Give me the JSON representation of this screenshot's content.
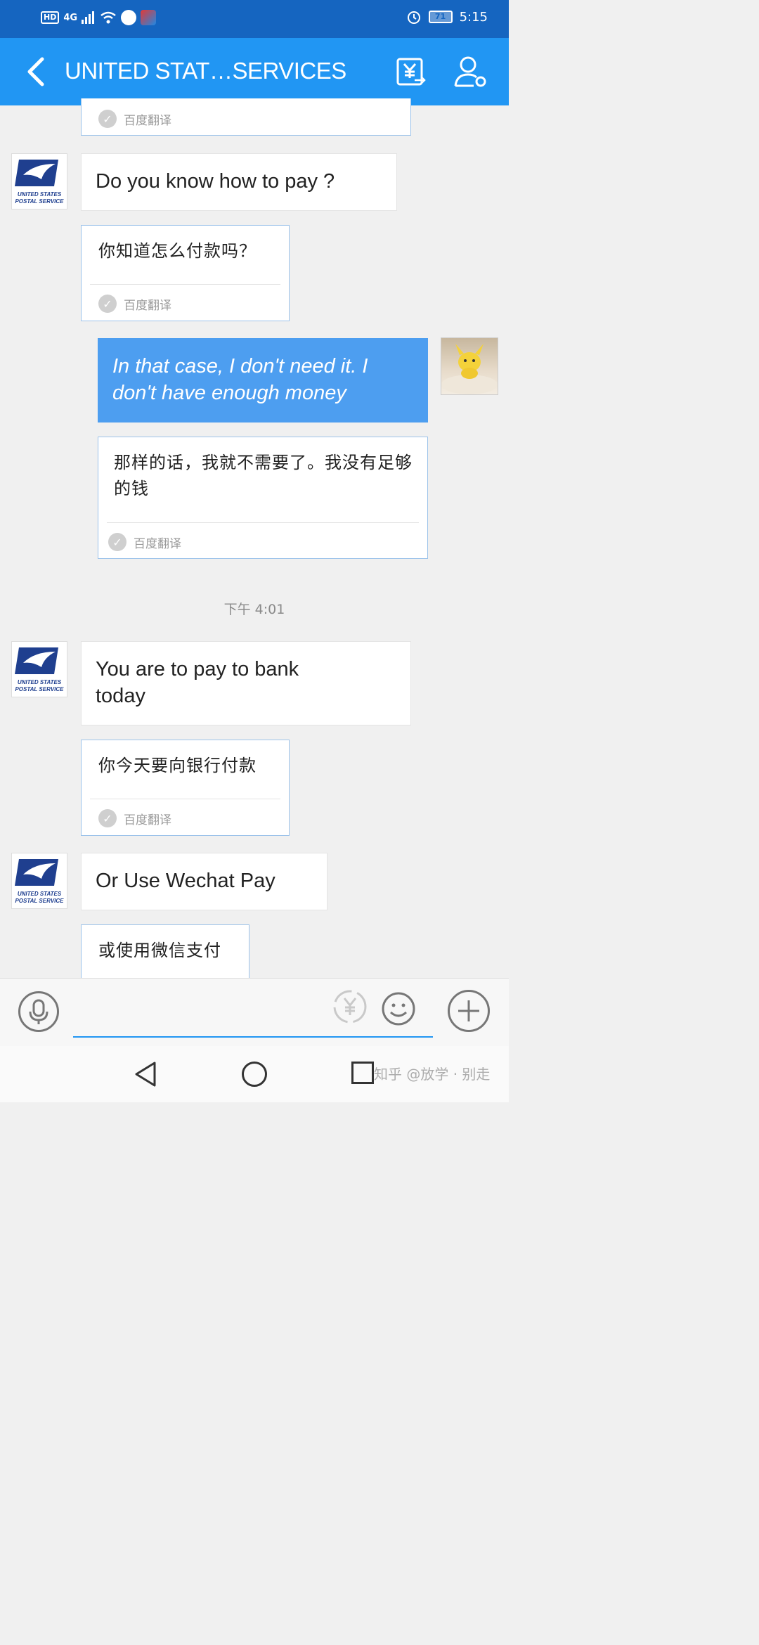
{
  "statusbar": {
    "hd": "HD",
    "network": "4G",
    "battery": "71",
    "time": "5:15"
  },
  "header": {
    "title": "UNITED STAT…SERVICES",
    "back_icon": "chevron-left-icon",
    "currency_icon": "yen-convert-icon",
    "profile_icon": "user-settings-icon"
  },
  "translation_source": "百度翻译",
  "usps_logo": {
    "line1": "UNITED STATES",
    "line2": "POSTAL SERVICE"
  },
  "messages": [
    {
      "side": "in",
      "text": "Do you know how to pay ?"
    },
    {
      "side": "in",
      "translation": "你知道怎么付款吗？"
    },
    {
      "side": "out",
      "text": "In that case, I don't need it. I don't have enough money"
    },
    {
      "side": "out",
      "translation": "那样的话，我就不需要了。我没有足够的钱"
    },
    {
      "side": "in",
      "text": "You are to pay to bank today"
    },
    {
      "side": "in",
      "translation": "你今天要向银行付款"
    },
    {
      "side": "in",
      "text": "Or Use Wechat Pay"
    },
    {
      "side": "in",
      "translation": "或使用微信支付"
    }
  ],
  "timestamp": "下午 4:01",
  "watermark": "知乎 @放学 · 别走",
  "colors": {
    "statusbar": "#1565c0",
    "header": "#2196f3",
    "outgoing_bubble": "#4d9ef0",
    "background": "#f0f0f0"
  }
}
